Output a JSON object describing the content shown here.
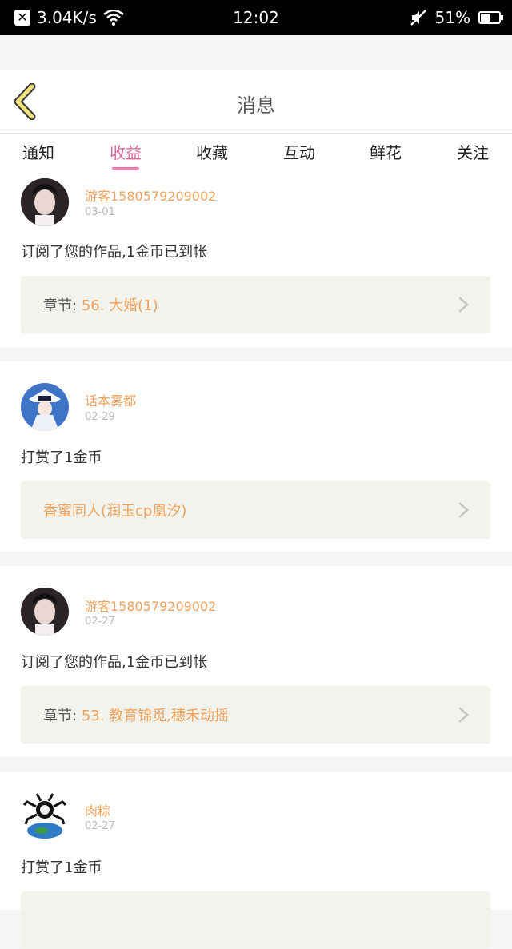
{
  "status_bar": {
    "network_speed": "3.04K/s",
    "time": "12:02",
    "battery": "51%",
    "battery_level": 0.51
  },
  "header": {
    "title": "消息",
    "back_icon": "chevron-left-icon"
  },
  "tabs": [
    {
      "label": "通知",
      "active": false
    },
    {
      "label": "收益",
      "active": true
    },
    {
      "label": "收藏",
      "active": false
    },
    {
      "label": "互动",
      "active": false
    },
    {
      "label": "鲜花",
      "active": false
    },
    {
      "label": "关注",
      "active": false
    }
  ],
  "colors": {
    "accent_tab": "#e0679e",
    "username": "#f0a25b",
    "chapter_value": "#f0a25b"
  },
  "messages": [
    {
      "user": "游客1580579209002",
      "date": "03-01",
      "action": "订阅了您的作品,1金币已到帐",
      "chapter_label": "章节:",
      "chapter_value": "56. 大婚(1)"
    },
    {
      "user": "话本雾都",
      "date": "02-29",
      "action": "打赏了1金币",
      "chapter_label": "",
      "chapter_value": "香蜜同人(润玉cp凰汐)"
    },
    {
      "user": "游客1580579209002",
      "date": "02-27",
      "action": "订阅了您的作品,1金币已到帐",
      "chapter_label": "章节:",
      "chapter_value": "53. 教育锦觅,穗禾动摇"
    },
    {
      "user": "肉粽",
      "date": "02-27",
      "action": "打赏了1金币",
      "chapter_label": "",
      "chapter_value": ""
    }
  ]
}
